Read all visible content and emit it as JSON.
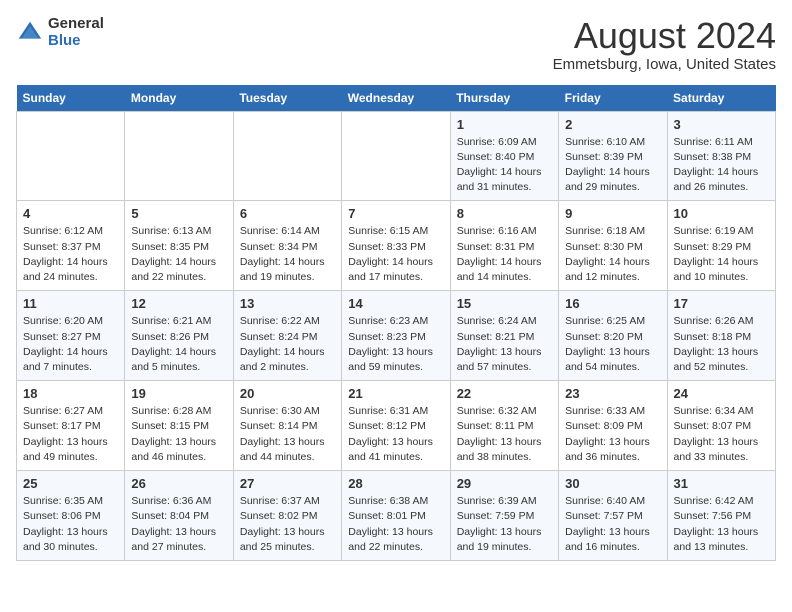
{
  "logo": {
    "general": "General",
    "blue": "Blue"
  },
  "title": "August 2024",
  "subtitle": "Emmetsburg, Iowa, United States",
  "days_header": [
    "Sunday",
    "Monday",
    "Tuesday",
    "Wednesday",
    "Thursday",
    "Friday",
    "Saturday"
  ],
  "weeks": [
    [
      {
        "day": "",
        "info": ""
      },
      {
        "day": "",
        "info": ""
      },
      {
        "day": "",
        "info": ""
      },
      {
        "day": "",
        "info": ""
      },
      {
        "day": "1",
        "info": "Sunrise: 6:09 AM\nSunset: 8:40 PM\nDaylight: 14 hours and 31 minutes."
      },
      {
        "day": "2",
        "info": "Sunrise: 6:10 AM\nSunset: 8:39 PM\nDaylight: 14 hours and 29 minutes."
      },
      {
        "day": "3",
        "info": "Sunrise: 6:11 AM\nSunset: 8:38 PM\nDaylight: 14 hours and 26 minutes."
      }
    ],
    [
      {
        "day": "4",
        "info": "Sunrise: 6:12 AM\nSunset: 8:37 PM\nDaylight: 14 hours and 24 minutes."
      },
      {
        "day": "5",
        "info": "Sunrise: 6:13 AM\nSunset: 8:35 PM\nDaylight: 14 hours and 22 minutes."
      },
      {
        "day": "6",
        "info": "Sunrise: 6:14 AM\nSunset: 8:34 PM\nDaylight: 14 hours and 19 minutes."
      },
      {
        "day": "7",
        "info": "Sunrise: 6:15 AM\nSunset: 8:33 PM\nDaylight: 14 hours and 17 minutes."
      },
      {
        "day": "8",
        "info": "Sunrise: 6:16 AM\nSunset: 8:31 PM\nDaylight: 14 hours and 14 minutes."
      },
      {
        "day": "9",
        "info": "Sunrise: 6:18 AM\nSunset: 8:30 PM\nDaylight: 14 hours and 12 minutes."
      },
      {
        "day": "10",
        "info": "Sunrise: 6:19 AM\nSunset: 8:29 PM\nDaylight: 14 hours and 10 minutes."
      }
    ],
    [
      {
        "day": "11",
        "info": "Sunrise: 6:20 AM\nSunset: 8:27 PM\nDaylight: 14 hours and 7 minutes."
      },
      {
        "day": "12",
        "info": "Sunrise: 6:21 AM\nSunset: 8:26 PM\nDaylight: 14 hours and 5 minutes."
      },
      {
        "day": "13",
        "info": "Sunrise: 6:22 AM\nSunset: 8:24 PM\nDaylight: 14 hours and 2 minutes."
      },
      {
        "day": "14",
        "info": "Sunrise: 6:23 AM\nSunset: 8:23 PM\nDaylight: 13 hours and 59 minutes."
      },
      {
        "day": "15",
        "info": "Sunrise: 6:24 AM\nSunset: 8:21 PM\nDaylight: 13 hours and 57 minutes."
      },
      {
        "day": "16",
        "info": "Sunrise: 6:25 AM\nSunset: 8:20 PM\nDaylight: 13 hours and 54 minutes."
      },
      {
        "day": "17",
        "info": "Sunrise: 6:26 AM\nSunset: 8:18 PM\nDaylight: 13 hours and 52 minutes."
      }
    ],
    [
      {
        "day": "18",
        "info": "Sunrise: 6:27 AM\nSunset: 8:17 PM\nDaylight: 13 hours and 49 minutes."
      },
      {
        "day": "19",
        "info": "Sunrise: 6:28 AM\nSunset: 8:15 PM\nDaylight: 13 hours and 46 minutes."
      },
      {
        "day": "20",
        "info": "Sunrise: 6:30 AM\nSunset: 8:14 PM\nDaylight: 13 hours and 44 minutes."
      },
      {
        "day": "21",
        "info": "Sunrise: 6:31 AM\nSunset: 8:12 PM\nDaylight: 13 hours and 41 minutes."
      },
      {
        "day": "22",
        "info": "Sunrise: 6:32 AM\nSunset: 8:11 PM\nDaylight: 13 hours and 38 minutes."
      },
      {
        "day": "23",
        "info": "Sunrise: 6:33 AM\nSunset: 8:09 PM\nDaylight: 13 hours and 36 minutes."
      },
      {
        "day": "24",
        "info": "Sunrise: 6:34 AM\nSunset: 8:07 PM\nDaylight: 13 hours and 33 minutes."
      }
    ],
    [
      {
        "day": "25",
        "info": "Sunrise: 6:35 AM\nSunset: 8:06 PM\nDaylight: 13 hours and 30 minutes."
      },
      {
        "day": "26",
        "info": "Sunrise: 6:36 AM\nSunset: 8:04 PM\nDaylight: 13 hours and 27 minutes."
      },
      {
        "day": "27",
        "info": "Sunrise: 6:37 AM\nSunset: 8:02 PM\nDaylight: 13 hours and 25 minutes."
      },
      {
        "day": "28",
        "info": "Sunrise: 6:38 AM\nSunset: 8:01 PM\nDaylight: 13 hours and 22 minutes."
      },
      {
        "day": "29",
        "info": "Sunrise: 6:39 AM\nSunset: 7:59 PM\nDaylight: 13 hours and 19 minutes."
      },
      {
        "day": "30",
        "info": "Sunrise: 6:40 AM\nSunset: 7:57 PM\nDaylight: 13 hours and 16 minutes."
      },
      {
        "day": "31",
        "info": "Sunrise: 6:42 AM\nSunset: 7:56 PM\nDaylight: 13 hours and 13 minutes."
      }
    ]
  ]
}
